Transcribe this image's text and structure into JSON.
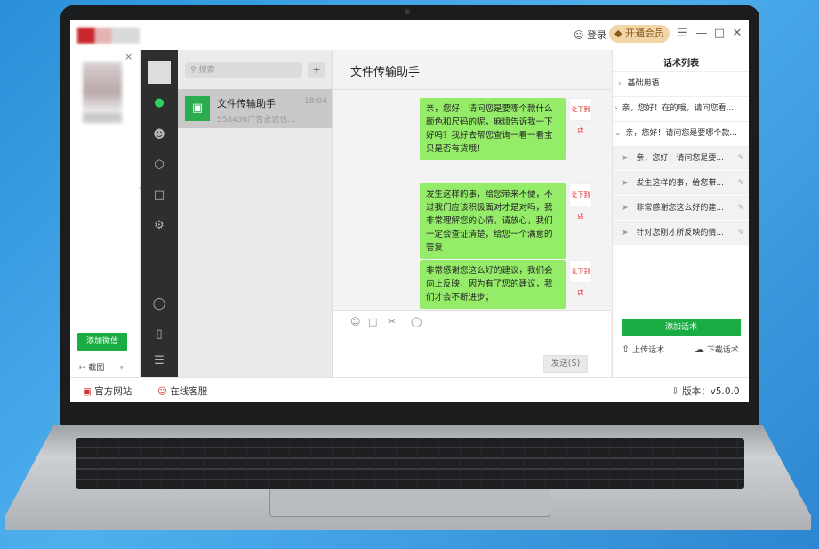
{
  "colors": {
    "accent_green": "#19ad43",
    "bubble_green": "#95ec69",
    "vip_gold": "#f3d6a8",
    "background_blue": "#2a8fd8"
  },
  "header": {
    "login_label": "登录",
    "vip_label": "开通会员",
    "menu_icon": "menu-icon",
    "min_icon": "minimize-icon",
    "max_icon": "maximize-icon",
    "close_icon": "close-icon"
  },
  "left_panel": {
    "close_glyph": "×",
    "add_wechat_label": "添加微信",
    "screenshot_label": "截图"
  },
  "wechat": {
    "search_placeholder": "搜索",
    "plus_glyph": "+",
    "session": {
      "name": "文件传输助手",
      "time": "18:04",
      "preview": "558436广告永远也..."
    },
    "chat_title": "文件传输助手",
    "messages": [
      {
        "text": "亲，您好！请问您是要哪个款什么颜色和尺码的呢，麻烦告诉我一下好吗？我好去帮您查询一看一看宝贝是否有货哦！",
        "avatar_label": "让下到店"
      },
      {
        "text": "发生这样的事，给您带来不便，不过我们应该积极面对才是对吗，我非常理解您的心情，请放心，我们一定会查证清楚，给您一个满意的答复",
        "avatar_label": "让下到店"
      },
      {
        "text": "非常感谢您这么好的建议，我们会向上反映，因为有了您的建议，我们才会不断进步；",
        "avatar_label": "让下到店"
      }
    ],
    "send_label": "发送(S)"
  },
  "script_panel": {
    "title": "话术列表",
    "groups": [
      {
        "label": "基础用语",
        "arrow": "›"
      },
      {
        "label": "亲，您好！在的哦，请问您看...",
        "arrow": "›"
      },
      {
        "label": "亲，您好！请问您是要哪个款...",
        "arrow": "⌄"
      }
    ],
    "items": [
      {
        "label": "亲，您好！请问您是要..."
      },
      {
        "label": "发生这样的事，给您带..."
      },
      {
        "label": "非常感谢您这么好的建..."
      },
      {
        "label": "针对您刚才所反映的情..."
      }
    ],
    "add_label": "添加话术",
    "upload_label": "上传话术",
    "download_label": "下载话术"
  },
  "footer": {
    "official_site": "官方网站",
    "online_service": "在线客服",
    "version": "版本：v5.0.0"
  }
}
